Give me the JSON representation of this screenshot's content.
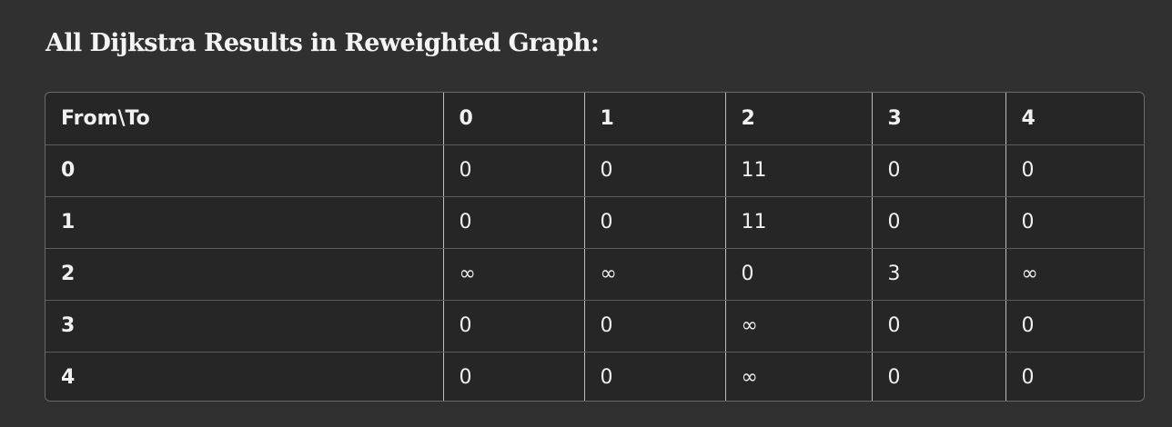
{
  "heading": "All Dijkstra Results in Reweighted Graph:",
  "table": {
    "corner": "From\\To",
    "columns": [
      "0",
      "1",
      "2",
      "3",
      "4"
    ],
    "rows": [
      {
        "label": "0",
        "cells": [
          "0",
          "0",
          "11",
          "0",
          "0"
        ]
      },
      {
        "label": "1",
        "cells": [
          "0",
          "0",
          "11",
          "0",
          "0"
        ]
      },
      {
        "label": "2",
        "cells": [
          "∞",
          "∞",
          "0",
          "3",
          "∞"
        ]
      },
      {
        "label": "3",
        "cells": [
          "0",
          "0",
          "∞",
          "0",
          "0"
        ]
      },
      {
        "label": "4",
        "cells": [
          "0",
          "0",
          "∞",
          "0",
          "0"
        ]
      }
    ]
  }
}
